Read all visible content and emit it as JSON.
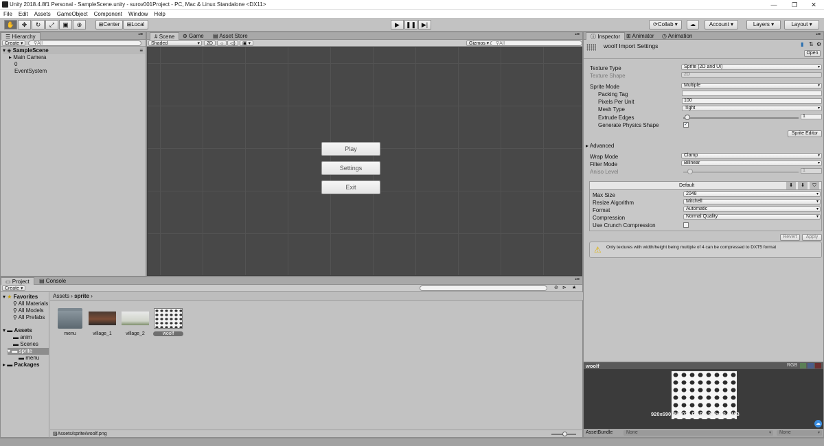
{
  "window": {
    "title": "Unity 2018.4.8f1 Personal - SampleScene.unity - surov001Project - PC, Mac & Linux Standalone <DX11>",
    "minimize": "—",
    "maximize": "❐",
    "close": "✕"
  },
  "menu": [
    "File",
    "Edit",
    "Assets",
    "GameObject",
    "Component",
    "Window",
    "Help"
  ],
  "toolbar": {
    "pivot": "Center",
    "space": "Local",
    "collab": "Collab",
    "account": "Account",
    "layers": "Layers",
    "layout": "Layout"
  },
  "hierarchy": {
    "tab": "Hierarchy",
    "create": "Create",
    "search_placeholder": "All",
    "scene": "SampleScene",
    "items": [
      "Main Camera",
      "0",
      "EventSystem"
    ]
  },
  "scene": {
    "tabs": [
      "Scene",
      "Game",
      "Asset Store"
    ],
    "shading": "Shaded",
    "mode2d": "2D",
    "gizmos": "Gizmos",
    "search_placeholder": "All",
    "buttons": [
      "Play",
      "Settings",
      "Exit"
    ]
  },
  "project": {
    "tabs": [
      "Project",
      "Console"
    ],
    "create": "Create",
    "favorites": "Favorites",
    "favorite_items": [
      "All Materials",
      "All Models",
      "All Prefabs"
    ],
    "assets_root": "Assets",
    "asset_folders": [
      "anim",
      "Scenes",
      "sprite"
    ],
    "sprite_children": [
      "menu"
    ],
    "packages": "Packages",
    "breadcrumb": [
      "Assets",
      "sprite"
    ],
    "assets": [
      "menu",
      "village_1",
      "village_2",
      "woolf"
    ],
    "status_path": "Assets/sprite/woolf.png"
  },
  "inspector": {
    "tabs": [
      "Inspector",
      "Animator",
      "Animation"
    ],
    "header": "woolf Import Settings",
    "open": "Open",
    "texture_type_label": "Texture Type",
    "texture_type": "Sprite (2D and UI)",
    "texture_shape_label": "Texture Shape",
    "texture_shape": "2D",
    "sprite_mode_label": "Sprite Mode",
    "sprite_mode": "Multiple",
    "packing_tag_label": "Packing Tag",
    "packing_tag": "",
    "ppu_label": "Pixels Per Unit",
    "ppu": "100",
    "mesh_type_label": "Mesh Type",
    "mesh_type": "Tight",
    "extrude_label": "Extrude Edges",
    "extrude": "1",
    "physics_label": "Generate Physics Shape",
    "sprite_editor": "Sprite Editor",
    "advanced": "Advanced",
    "wrap_label": "Wrap Mode",
    "wrap": "Clamp",
    "filter_label": "Filter Mode",
    "filter": "Bilinear",
    "aniso_label": "Aniso Level",
    "aniso": "1",
    "platform_default": "Default",
    "max_size_label": "Max Size",
    "max_size": "2048",
    "resize_label": "Resize Algorithm",
    "resize": "Mitchell",
    "format_label": "Format",
    "format": "Automatic",
    "compression_label": "Compression",
    "compression": "Normal Quality",
    "crunch_label": "Use Crunch Compression",
    "revert": "Revert",
    "apply": "Apply",
    "warning": "Only textures with width/height being multiple of 4 can be compressed to DXT5 format"
  },
  "preview": {
    "title": "woolf",
    "rgb": "RGB",
    "info": "920x690 (NPOT) RGBA 32 bit 2.4 MB",
    "assetbundle_label": "AssetBundle",
    "bundle": "None",
    "variant": "None"
  }
}
